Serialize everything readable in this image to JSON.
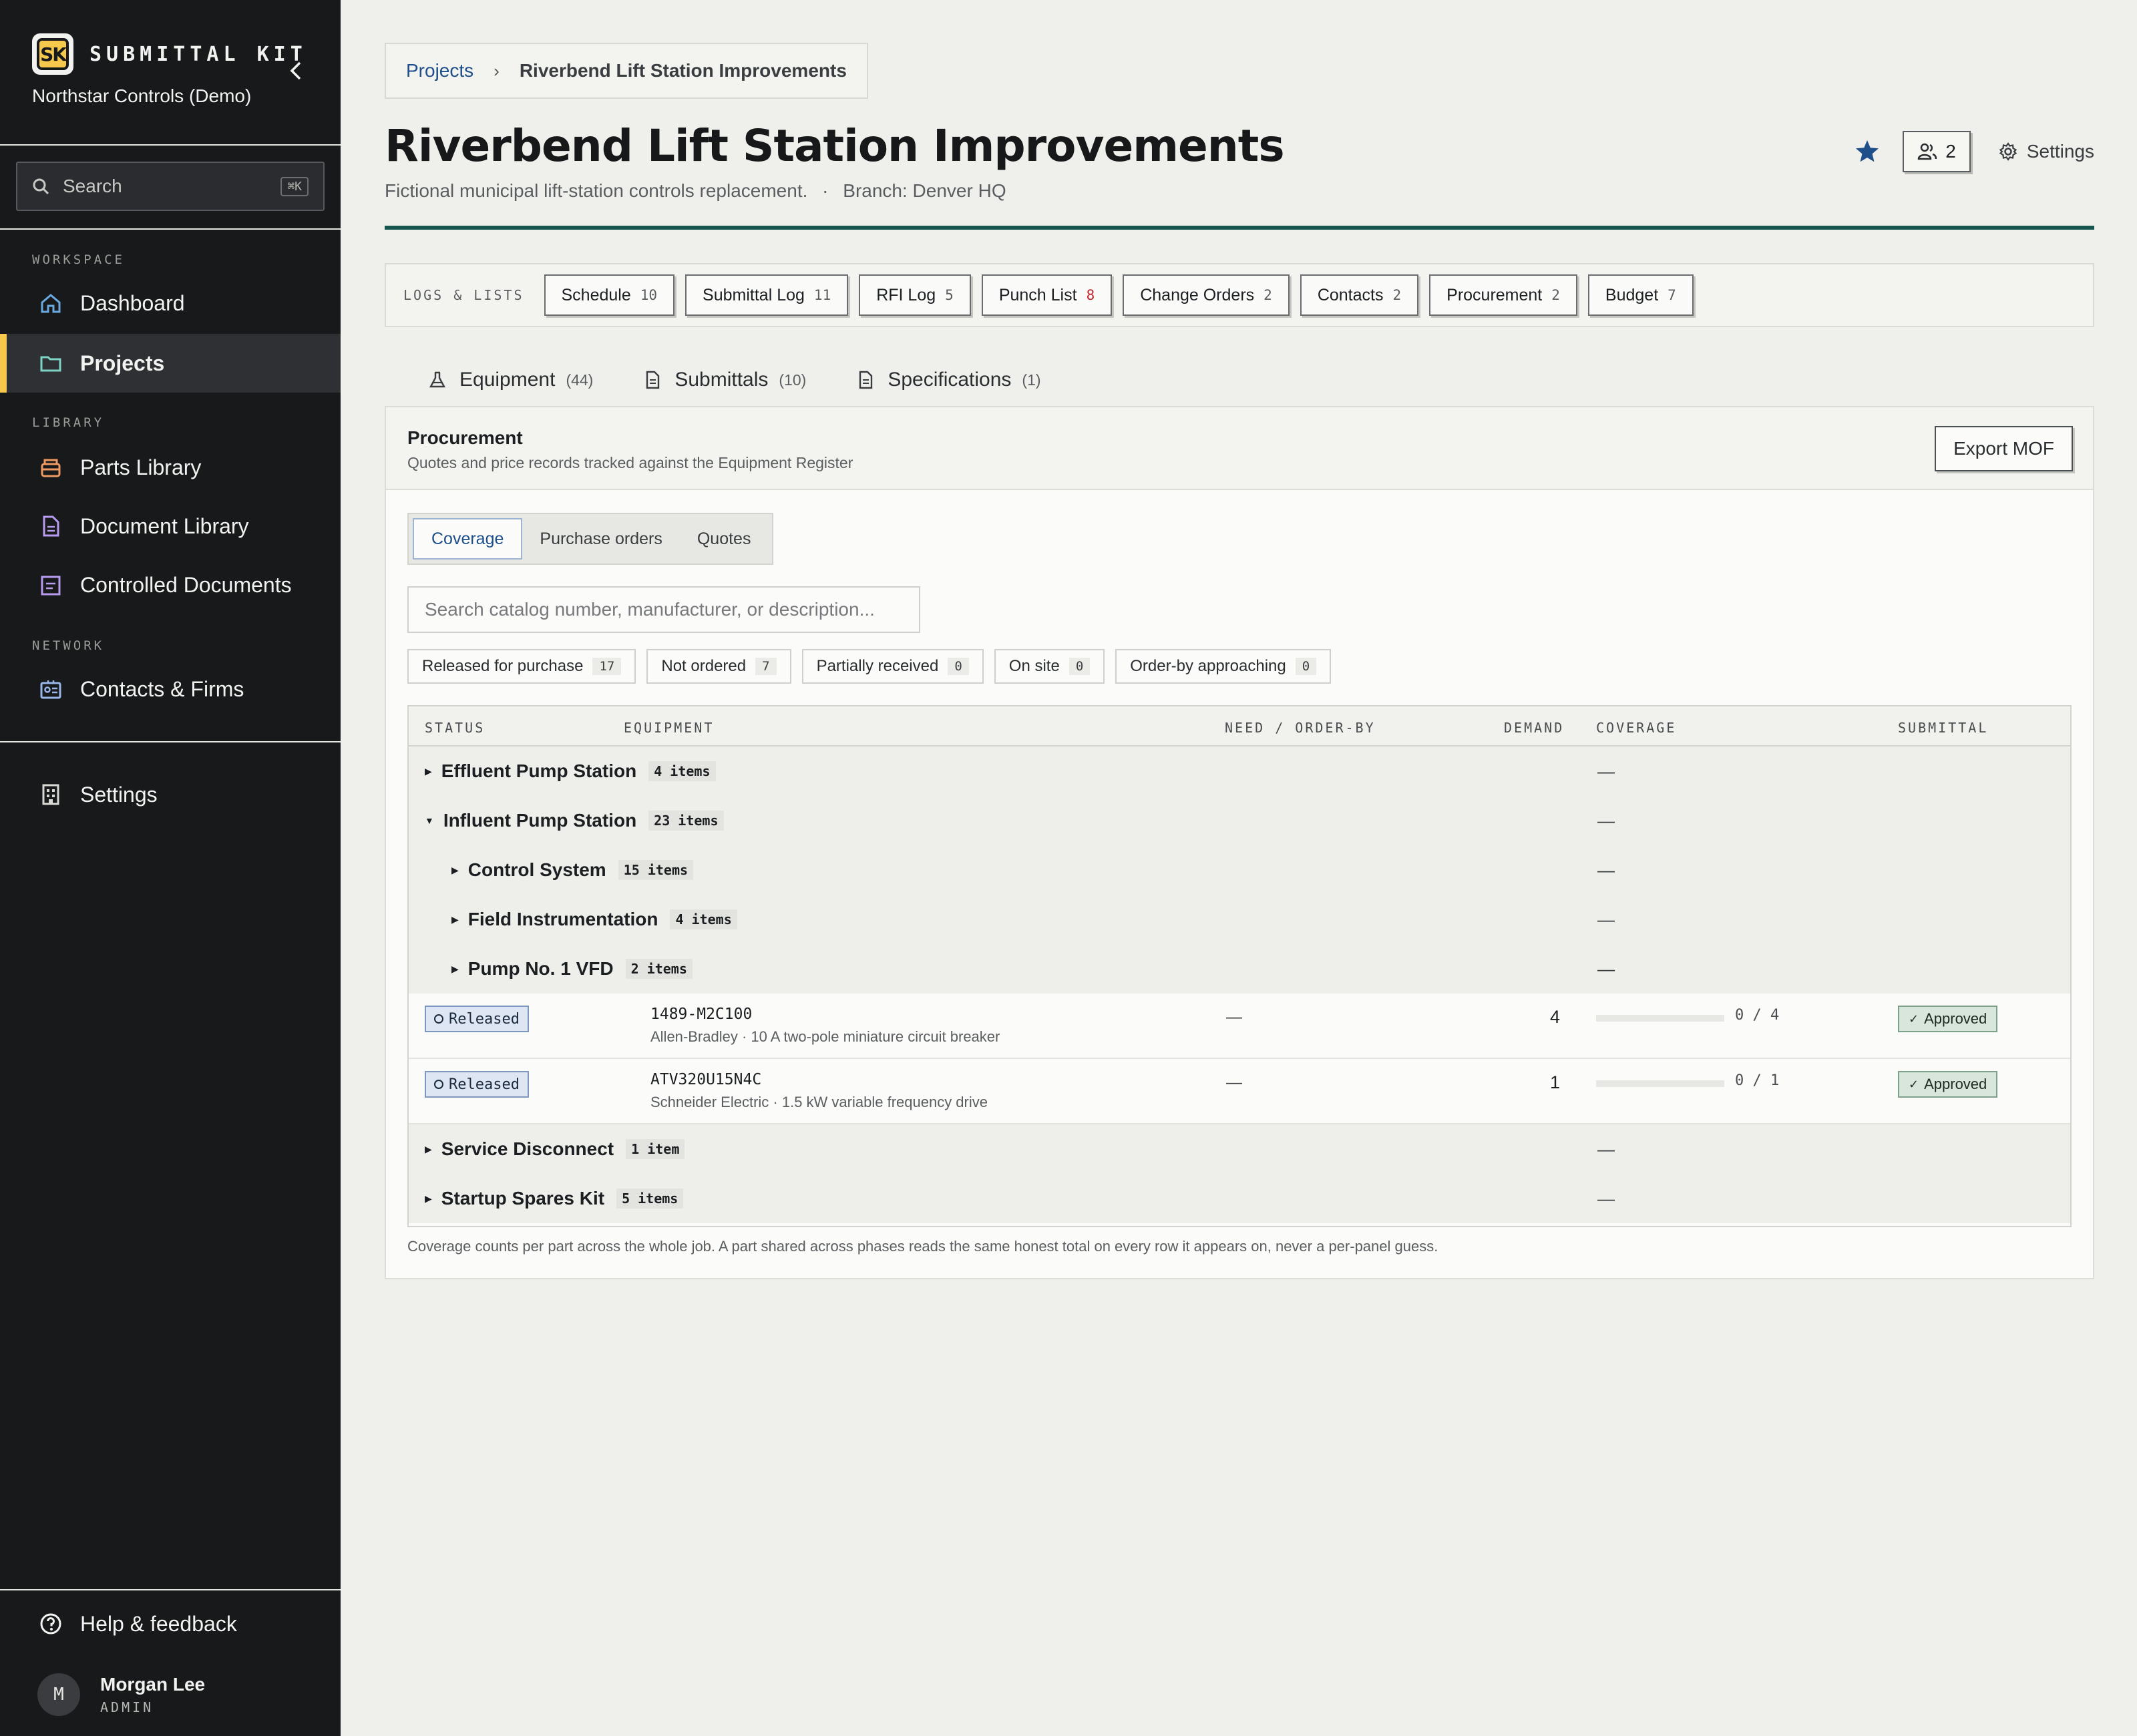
{
  "app": {
    "logo_text": "SK",
    "brand_name": "SUBMITTAL KIT",
    "org_name": "Northstar Controls (Demo)"
  },
  "sidebar": {
    "search_label": "Search",
    "search_shortcut": "⌘K",
    "sections": {
      "workspace": "WORKSPACE",
      "library": "LIBRARY",
      "network": "NETWORK"
    },
    "items": {
      "dashboard": "Dashboard",
      "projects": "Projects",
      "parts_library": "Parts Library",
      "document_library": "Document Library",
      "controlled_documents": "Controlled Documents",
      "contacts_firms": "Contacts & Firms",
      "settings": "Settings",
      "help": "Help & feedback"
    },
    "active_item": "projects",
    "user": {
      "initial": "M",
      "name": "Morgan Lee",
      "role": "ADMIN"
    }
  },
  "breadcrumb": {
    "root": "Projects",
    "current": "Riverbend Lift Station Improvements"
  },
  "header": {
    "title": "Riverbend Lift Station Improvements",
    "description": "Fictional municipal lift-station controls replacement.",
    "separator": "·",
    "branch": "Branch: Denver HQ",
    "members_count": "2",
    "settings_label": "Settings",
    "accent_color": "#15574e",
    "star_color": "#1f4f8a"
  },
  "logs": {
    "label": "LOGS & LISTS",
    "chips": [
      {
        "label": "Schedule",
        "count": "10"
      },
      {
        "label": "Submittal Log",
        "count": "11"
      },
      {
        "label": "RFI Log",
        "count": "5"
      },
      {
        "label": "Punch List",
        "count": "8"
      },
      {
        "label": "Change Orders",
        "count": "2"
      },
      {
        "label": "Contacts",
        "count": "2"
      },
      {
        "label": "Procurement",
        "count": "2"
      },
      {
        "label": "Budget",
        "count": "7"
      }
    ]
  },
  "tabs": [
    {
      "label": "Equipment",
      "count": "(44)",
      "icon": "flask-icon"
    },
    {
      "label": "Submittals",
      "count": "(10)",
      "icon": "document-icon"
    },
    {
      "label": "Specifications",
      "count": "(1)",
      "icon": "document-icon"
    }
  ],
  "procurement": {
    "title": "Procurement",
    "description": "Quotes and price records tracked against the Equipment Register",
    "export_label": "Export MOF",
    "segments": [
      "Coverage",
      "Purchase orders",
      "Quotes"
    ],
    "active_segment": "Coverage",
    "search_placeholder": "Search catalog number, manufacturer, or description...",
    "search_value": "",
    "filters": [
      {
        "label": "Released for purchase",
        "count": "17"
      },
      {
        "label": "Not ordered",
        "count": "7"
      },
      {
        "label": "Partially received",
        "count": "0"
      },
      {
        "label": "On site",
        "count": "0"
      },
      {
        "label": "Order-by approaching",
        "count": "0"
      }
    ],
    "columns": {
      "status": "STATUS",
      "equipment": "EQUIPMENT",
      "need": "NEED / ORDER-BY",
      "demand": "DEMAND",
      "coverage": "COVERAGE",
      "submittal": "SUBMITTAL"
    },
    "empty_mark": "—",
    "groups": {
      "effluent": {
        "name": "Effluent Pump Station",
        "count": "4 items",
        "expanded": false
      },
      "influent": {
        "name": "Influent Pump Station",
        "count": "23 items",
        "expanded": true
      },
      "control": {
        "name": "Control System",
        "count": "15 items",
        "expanded": false
      },
      "field": {
        "name": "Field Instrumentation",
        "count": "4 items",
        "expanded": false
      },
      "pump1": {
        "name": "Pump No. 1 VFD",
        "count": "2 items",
        "expanded": true
      },
      "service": {
        "name": "Service Disconnect",
        "count": "1 item",
        "expanded": false
      },
      "spares": {
        "name": "Startup Spares Kit",
        "count": "5 items",
        "expanded": false
      }
    },
    "items": [
      {
        "status": "Released",
        "catalog": "1489-M2C100",
        "description": "Allen-Bradley · 10 A two-pole miniature circuit breaker",
        "need": "—",
        "demand": "4",
        "coverage_text": "0 / 4",
        "coverage_fraction": 0,
        "submittal": "Approved"
      },
      {
        "status": "Released",
        "catalog": "ATV320U15N4C",
        "description": "Schneider Electric · 1.5 kW variable frequency drive",
        "need": "—",
        "demand": "1",
        "coverage_text": "0 / 1",
        "coverage_fraction": 0,
        "submittal": "Approved"
      }
    ],
    "footnote": "Coverage counts per part across the whole job. A part shared across phases reads the same honest total on every row it appears on, never a per-panel guess."
  }
}
